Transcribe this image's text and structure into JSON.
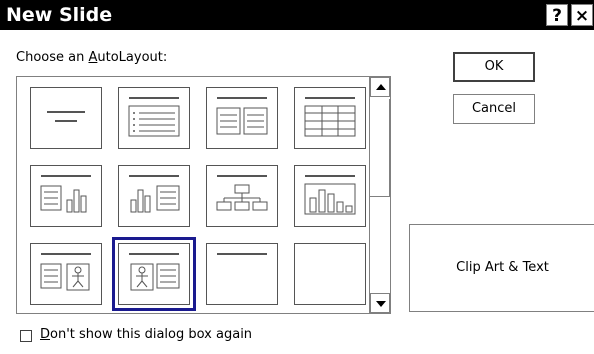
{
  "dialog": {
    "title": "New Slide",
    "help_label": "?",
    "close_label": "×"
  },
  "layout_picker": {
    "label_prefix": "Choose an ",
    "label_accel": "A",
    "label_suffix": "utoLayout:",
    "layouts": [
      {
        "icon": "title-slide-icon"
      },
      {
        "icon": "bulleted-list-icon"
      },
      {
        "icon": "two-column-text-icon"
      },
      {
        "icon": "table-icon"
      },
      {
        "icon": "text-and-chart-icon"
      },
      {
        "icon": "chart-and-text-icon"
      },
      {
        "icon": "organization-chart-icon"
      },
      {
        "icon": "chart-icon"
      },
      {
        "icon": "text-and-clip-art-icon"
      },
      {
        "icon": "clip-art-and-text-icon",
        "selected": true
      },
      {
        "icon": "title-only-icon"
      },
      {
        "icon": "blank-icon"
      }
    ]
  },
  "buttons": {
    "ok": "OK",
    "cancel": "Cancel"
  },
  "preview": {
    "layout_name": "Clip Art & Text"
  },
  "footer": {
    "dont_show_accel": "D",
    "dont_show_rest": "on't show this dialog box again",
    "dont_show_checked": false
  },
  "colors": {
    "selection": "#1a1a8f",
    "titlebar": "#000000"
  }
}
